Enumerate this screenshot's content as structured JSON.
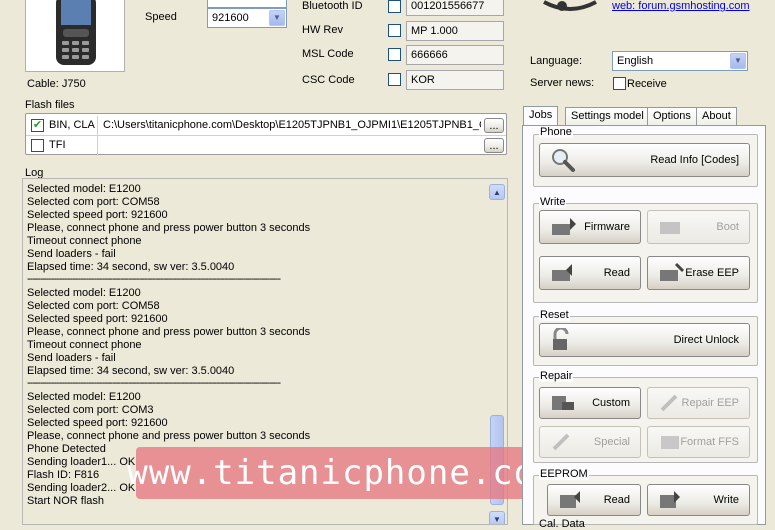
{
  "device": {
    "cable_label": "Cable: J750",
    "speed_label": "Speed",
    "speed_value": "921600"
  },
  "ids": {
    "bluetooth_label": "Bluetooth ID",
    "bluetooth_value": "001201556677",
    "hwrev_label": "HW Rev",
    "hwrev_value": "MP 1.000",
    "msl_label": "MSL Code",
    "msl_value": "666666",
    "csc_label": "CSC Code",
    "csc_value": "KOR"
  },
  "header_right": {
    "forum_link": "web: forum.gsmhosting.com",
    "language_label": "Language:",
    "language_value": "English",
    "server_news_label": "Server news:",
    "receive_label": "Receive"
  },
  "flash_files": {
    "title": "Flash files",
    "rows": [
      {
        "checked": true,
        "name": "BIN, CLA",
        "path": "C:\\Users\\titanicphone.com\\Desktop\\E1205TJPNB1_OJPMI1\\E1205TJPNB1_OJP",
        "browse": "..."
      },
      {
        "checked": false,
        "name": "TFI",
        "path": "",
        "browse": "..."
      }
    ]
  },
  "log": {
    "title": "Log",
    "lines": [
      "Selected model: E1200",
      "Selected com port: COM58",
      "Selected speed port: 921600",
      "Please, connect phone and press power button 3 seconds",
      "Timeout connect phone",
      "Send loaders - fail",
      "Elapsed time: 34 second, sw ver: 3.5.0040",
      "---",
      "Selected model: E1200",
      "Selected com port: COM58",
      "Selected speed port: 921600",
      "Please, connect phone and press power button 3 seconds",
      "Timeout connect phone",
      "Send loaders - fail",
      "Elapsed time: 34 second, sw ver: 3.5.0040",
      "---",
      "Selected model: E1200",
      "Selected com port: COM3",
      "Selected speed port: 921600",
      "Please, connect phone and press power button 3 seconds",
      "Phone Detected",
      "Sending loader1... OK",
      "Flash ID: F816",
      "Sending loader2... OK",
      "Start NOR flash"
    ]
  },
  "watermark": "www.titanicphone.com",
  "tabs": [
    "Jobs",
    "Settings model",
    "Options",
    "About"
  ],
  "jobs": {
    "phone_title": "Phone",
    "read_info": "Read Info [Codes]",
    "write_title": "Write",
    "firmware": "Firmware",
    "boot": "Boot",
    "read": "Read",
    "erase_eep": "Erase EEP",
    "reset_title": "Reset",
    "direct_unlock": "Direct Unlock",
    "repair_title": "Repair",
    "custom": "Custom",
    "repair_eep": "Repair EEP",
    "special": "Special",
    "format_ffs": "Format FFS",
    "eeprom_title": "EEPROM",
    "eeprom_read": "Read",
    "eeprom_write": "Write",
    "cal_data_title": "Cal. Data"
  }
}
